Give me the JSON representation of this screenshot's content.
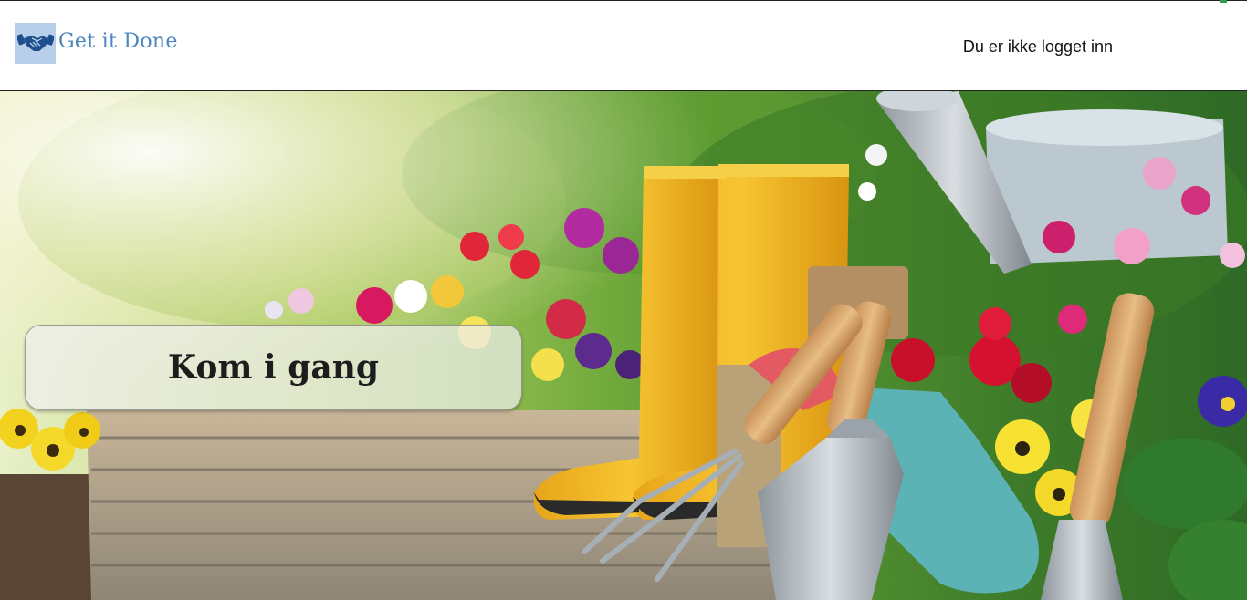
{
  "header": {
    "brand_name": "Get it Done",
    "logo_icon": "handshake-icon",
    "login_status": "Du er ikke logget inn"
  },
  "hero": {
    "image_icon": "garden-tools-photo",
    "cta_label": "Kom i gang"
  },
  "colors": {
    "brand_text": "#4c86bd",
    "logo_bg": "#b7cfe8",
    "cta_bg": "#eeeeee",
    "accent": "#2e9b4e"
  }
}
